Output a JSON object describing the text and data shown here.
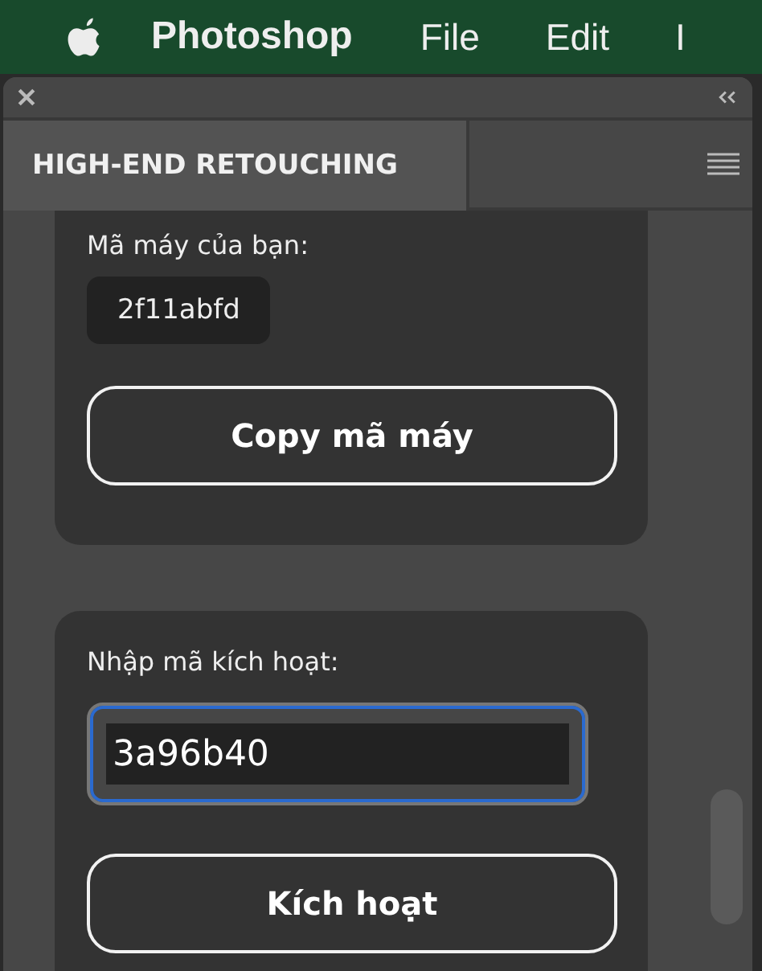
{
  "menu_bar": {
    "app_name": "Photoshop",
    "items": [
      "File",
      "Edit",
      "I"
    ]
  },
  "panel": {
    "tabs": [
      {
        "label": "HIGH-END RETOUCHING",
        "selected": true
      }
    ]
  },
  "machine_code_card": {
    "label": "Mã máy của bạn:",
    "code": "2f11abfd",
    "button": "Copy mã máy"
  },
  "activation_card": {
    "label": "Nhập mã kích hoạt:",
    "input": {
      "value": "3a96b40",
      "focused": true
    },
    "button": "Kích hoạt"
  }
}
